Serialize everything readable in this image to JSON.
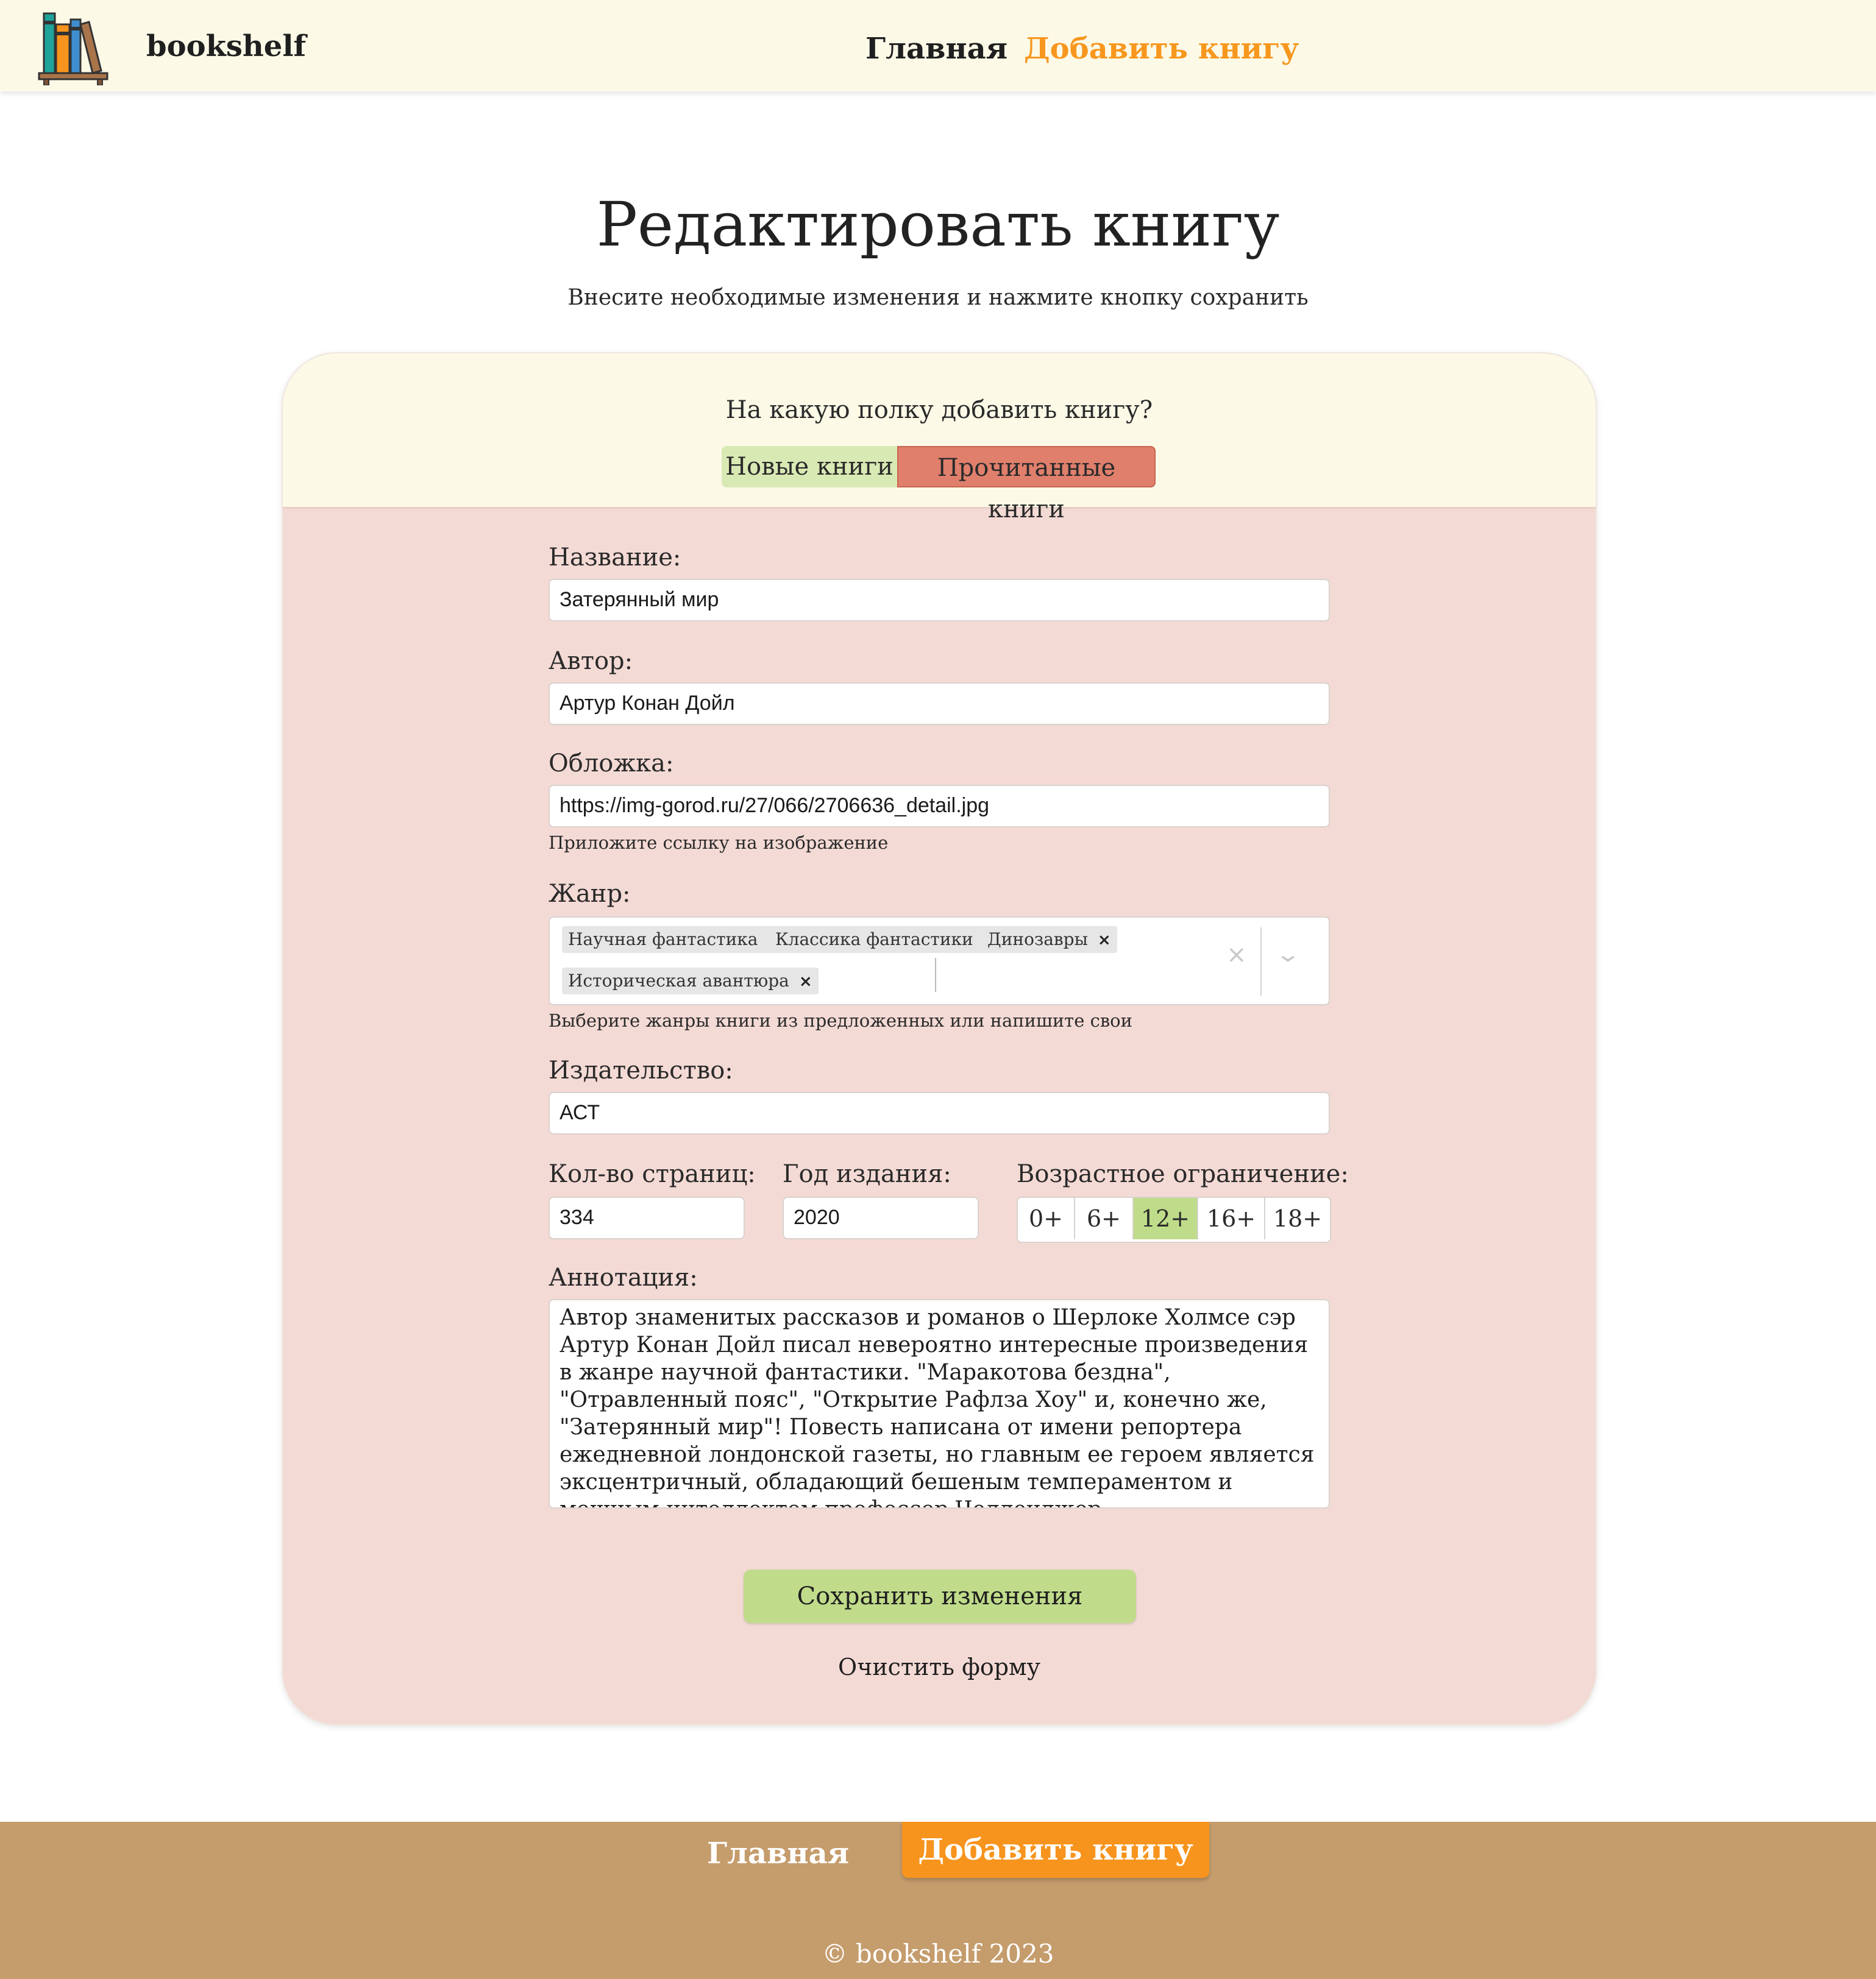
{
  "header": {
    "brand": "bookshelf",
    "nav": {
      "home": "Главная",
      "add_book": "Добавить книгу"
    },
    "accent_color": "#f7971e"
  },
  "page": {
    "title": "Редактировать книгу",
    "subtitle": "Внесите необходимые изменения и нажмите кнопку сохранить"
  },
  "shelf": {
    "question": "На какую полку добавить книгу?",
    "options": [
      "Новые книги",
      "Прочитанные книги"
    ],
    "selected": "Прочитанные книги"
  },
  "form": {
    "title_label": "Название:",
    "title_value": "Затерянный мир",
    "author_label": "Автор:",
    "author_value": "Артур Конан Дойл",
    "cover_label": "Обложка:",
    "cover_value": "https://img-gorod.ru/27/066/2706636_detail.jpg",
    "cover_hint": "Приложите ссылку на изображение",
    "genre_label": "Жанр:",
    "genres": [
      "Научная фантастика",
      "Классика фантастики",
      "Динозавры",
      "Историческая авантюра"
    ],
    "genre_hint": "Выберите жанры книги из предложенных или напишите свои",
    "publisher_label": "Издательство:",
    "publisher_value": "АСТ",
    "pages_label": "Кол-во страниц:",
    "pages_value": "334",
    "year_label": "Год издания:",
    "year_value": "2020",
    "age_label": "Возрастное ограничение:",
    "age_options": [
      "0+",
      "6+",
      "12+",
      "16+",
      "18+"
    ],
    "age_selected": "12+",
    "annotation_label": "Аннотация:",
    "annotation_value": "Автор знаменитых рассказов и романов о Шерлоке Холмсе сэр Артур Конан Дойл писал невероятно интересные произведения в жанре научной фантастики. \"Маракотова бездна\", \"Отравленный пояс\", \"Открытие Рафлза Хоу\" и, конечно же, \"Затерянный мир\"! Повесть написана от имени репортера ежедневной лондонской газеты, но главным ее героем является эксцентричный, обладающий бешеным темпераментом и мощным интеллектом профессор Челленджер.",
    "save_button": "Сохранить изменения",
    "clear_button": "Очистить форму"
  },
  "footer": {
    "nav": {
      "home": "Главная",
      "add_book": "Добавить книгу"
    },
    "copyright": "© bookshelf  2023"
  },
  "icons": {
    "logo": "bookshelf-logo-icon",
    "chip_remove": "close-icon",
    "clear_all": "clear-icon",
    "dropdown": "chevron-down-icon"
  },
  "colors": {
    "header_bg": "#fcf9e7",
    "card_bg": "#f4dad5",
    "shelf_new": "#d9e9b4",
    "shelf_read": "#df7f6c",
    "age_active": "#bfdc8a",
    "save_button": "#c0dc8b",
    "footer_bg": "#c59c6c",
    "footer_active": "#f7941d"
  }
}
